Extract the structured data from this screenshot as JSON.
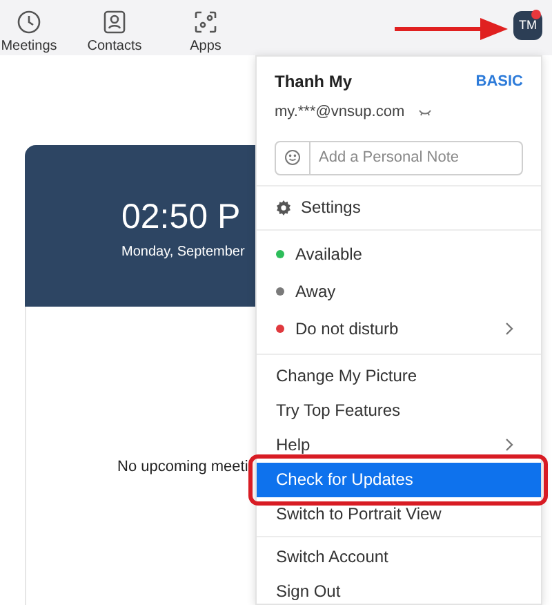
{
  "nav": [
    {
      "kind": "clock",
      "label": "Meetings"
    },
    {
      "kind": "contact",
      "label": "Contacts"
    },
    {
      "kind": "apps",
      "label": "Apps"
    }
  ],
  "avatar": {
    "initials": "TM",
    "notification": true
  },
  "main": {
    "time": "02:50 P",
    "date": "Monday, September",
    "empty_message": "No upcoming meeti"
  },
  "menu": {
    "name": "Thanh My",
    "plan": "BASIC",
    "email": "my.***@vnsup.com",
    "note": {
      "placeholder": "Add a Personal Note"
    },
    "groups": [
      [
        {
          "kind": "setting",
          "label": "Settings",
          "submenu": false,
          "selected": false
        }
      ],
      [
        {
          "kind": "status",
          "label": "Available",
          "color": "#2dbd5a",
          "submenu": false,
          "selected": false
        },
        {
          "kind": "status",
          "label": "Away",
          "color": "#7a7a7a",
          "submenu": false,
          "selected": false
        },
        {
          "kind": "status",
          "label": "Do not disturb",
          "color": "#e0393e",
          "submenu": true,
          "selected": false
        }
      ],
      [
        {
          "kind": "item",
          "label": "Change My Picture",
          "submenu": false,
          "selected": false
        },
        {
          "kind": "item",
          "label": "Try Top Features",
          "submenu": false,
          "selected": false
        },
        {
          "kind": "item",
          "label": "Help",
          "submenu": true,
          "selected": false
        },
        {
          "kind": "item",
          "label": "Check for Updates",
          "submenu": false,
          "selected": true
        },
        {
          "kind": "item",
          "label": "Switch to Portrait View",
          "submenu": false,
          "selected": false
        }
      ],
      [
        {
          "kind": "item",
          "label": "Switch Account",
          "submenu": false,
          "selected": false
        },
        {
          "kind": "item",
          "label": "Sign Out",
          "submenu": false,
          "selected": false
        }
      ]
    ]
  }
}
